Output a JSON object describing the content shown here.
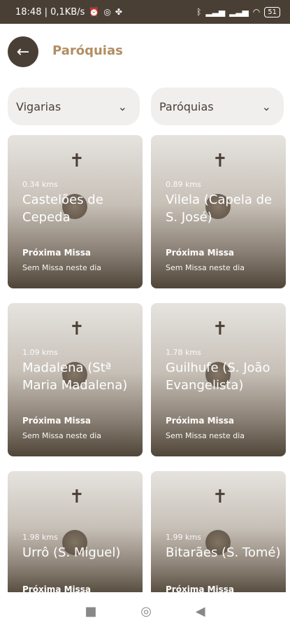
{
  "status_bar": {
    "time_speed": "18:48 | 0,1KB/s",
    "battery": "51",
    "left_icons": [
      "alarm-icon",
      "whatsapp-icon",
      "settings-icon"
    ],
    "right_icons": [
      "bluetooth-icon",
      "signal-icon",
      "signal-icon",
      "wifi-icon",
      "battery-icon"
    ]
  },
  "header": {
    "back_icon": "arrow-left-icon",
    "title": "Paróquias"
  },
  "filters": {
    "vigarias": "Vigarias",
    "paroquias": "Paróquias"
  },
  "cards": [
    {
      "distance": "0.34 kms",
      "name": "Castelões de Cepeda",
      "label": "Próxima Missa",
      "status": "Sem Missa neste dia"
    },
    {
      "distance": "0.89 kms",
      "name": "Vilela (Capela de S. José)",
      "label": "Próxima Missa",
      "status": "Sem Missa neste dia"
    },
    {
      "distance": "1.09 kms",
      "name": "Madalena (Stª Maria Madalena)",
      "label": "Próxima Missa",
      "status": "Sem Missa neste dia"
    },
    {
      "distance": "1.78 kms",
      "name": "Guilhufe (S. João Evangelista)",
      "label": "Próxima Missa",
      "status": "Sem Missa neste dia"
    },
    {
      "distance": "1.98 kms",
      "name": "Urrô (S. Miguel)",
      "label": "Próxima Missa",
      "status": ""
    },
    {
      "distance": "1.99 kms",
      "name": "Bitarães (S. Tomé)",
      "label": "Próxima Missa",
      "status": ""
    }
  ],
  "bottom_nav": [
    "square-icon",
    "circle-icon",
    "back-triangle-icon"
  ]
}
